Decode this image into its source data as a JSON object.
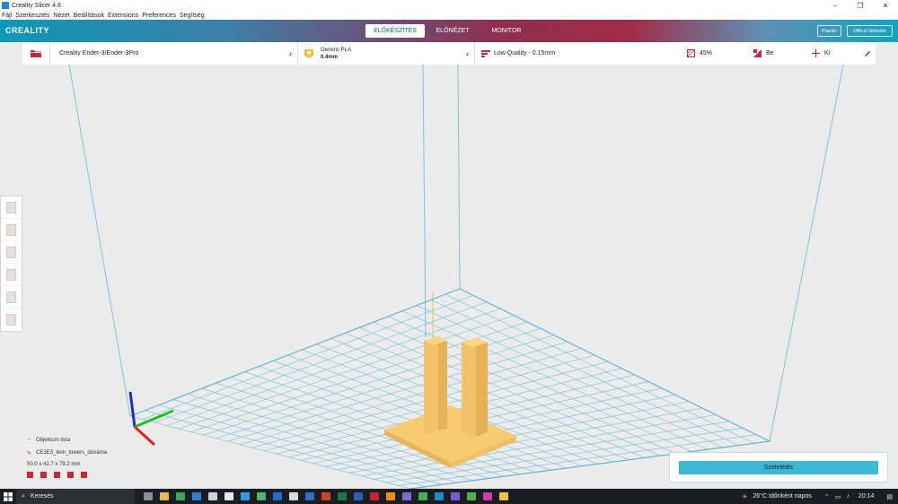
{
  "window": {
    "title": "Creality Slicer 4.8",
    "minimize": "–",
    "maximize": "❐",
    "close": "✕"
  },
  "menu": [
    "Fájl",
    "Szerkesztés",
    "Nézet",
    "Beállítások",
    "Extensions",
    "Preferences",
    "Segítség"
  ],
  "header": {
    "logo": "CREALITY",
    "tabs": [
      "ELŐKÉSZÍTÉS",
      "ELŐNÉZET",
      "MONITOR"
    ],
    "active_tab": 0,
    "buttons": [
      "Piactér",
      "Offical Website"
    ]
  },
  "toolbar": {
    "printer": "Creality Ender-3/Ender-3Pro",
    "material_name": "Generic PLA",
    "nozzle": "0.4mm",
    "profile": "Low Quality - 0.15mm",
    "infill": "45%",
    "support": "Be",
    "adhesion": "Ki"
  },
  "object_list": {
    "title": "Objektum lista",
    "filename": "CE3E3_twin_towers_dioráma",
    "dimensions": "50.0 x 42.7 x 79.2 mm"
  },
  "slice_button": "Szeletelés",
  "taskbar": {
    "search_placeholder": "Keresés",
    "weather": "26°C  Időnként napos",
    "time": "20:14"
  },
  "colors": {
    "accent": "#3cb7d4",
    "model": "#f5c76a",
    "grid": "#7fc4dc",
    "axis_x": "#e02020",
    "axis_y": "#20b020",
    "axis_z": "#1a2fd0"
  }
}
